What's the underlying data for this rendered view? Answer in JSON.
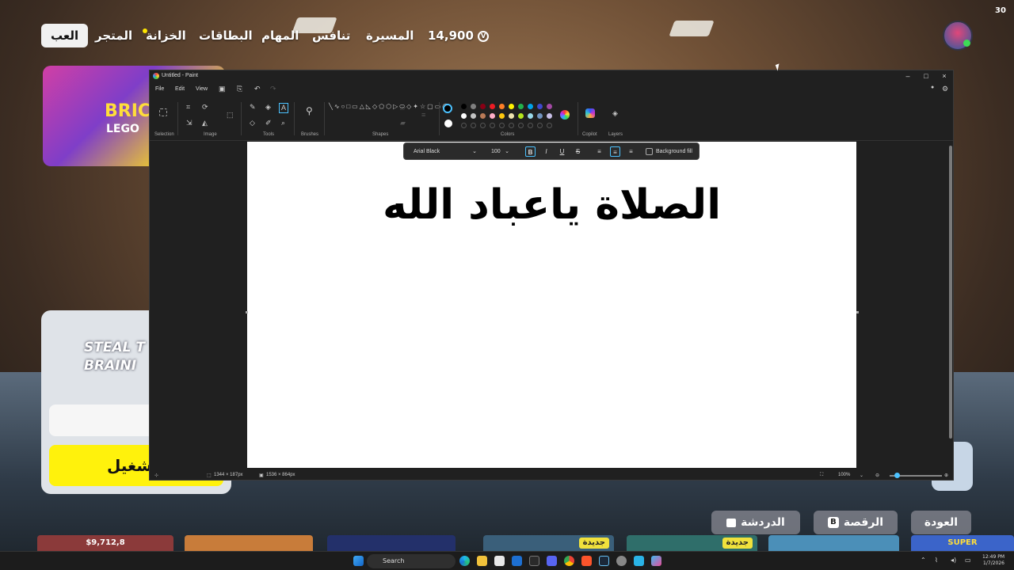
{
  "game": {
    "nav": [
      "العب",
      "المتجر",
      "الخزانة",
      "البطاقات",
      "المهام",
      "تنافس",
      "المسيرة"
    ],
    "vbucks": "14,900",
    "fps": "30",
    "promo_word": "BRIC",
    "promo_word2": "LEGO",
    "steal_title": "STEAL T\nBRAINI",
    "play_label": "شغيل",
    "bottom": {
      "chat": "الدردشة",
      "dance": "الرقصة",
      "dance_key": "B",
      "back": "العودة",
      "right_key": "B"
    },
    "tile_prices": "$9,712,8",
    "tile_badge": "جديدة",
    "tile_badge2": "جديدة",
    "tile_last": "SUPER"
  },
  "paint": {
    "title": "Untitled - Paint",
    "menu": [
      "File",
      "Edit",
      "View"
    ],
    "groups": {
      "selection": "Selection",
      "image": "Image",
      "tools": "Tools",
      "brushes": "Brushes",
      "shapes": "Shapes",
      "colors": "Colors",
      "copilot": "Copilot",
      "layers": "Layers"
    },
    "textbar": {
      "font": "Arial Black",
      "size": "100",
      "bold": "B",
      "italic": "I",
      "underline": "U",
      "strike": "S",
      "bg_fill": "Background fill"
    },
    "canvas_text": "الصلاة ياعباد الله",
    "status": {
      "selection_size": "1344 × 187px",
      "canvas_size": "1536 × 864px",
      "zoom": "100%"
    },
    "colors": [
      "#000000",
      "#7f7f7f",
      "#880015",
      "#ed1c24",
      "#ff7f27",
      "#fff200",
      "#22b14c",
      "#00a2e8",
      "#3f48cc",
      "#a349a4",
      "#ffffff",
      "#c3c3c3",
      "#b97a57",
      "#ffaec9",
      "#ffc90e",
      "#efe4b0",
      "#b5e61d",
      "#99d9ea",
      "#7092be",
      "#c8bfe7"
    ]
  },
  "taskbar": {
    "search": "Search",
    "time": "12:49 PM",
    "date": "1/7/2026"
  }
}
